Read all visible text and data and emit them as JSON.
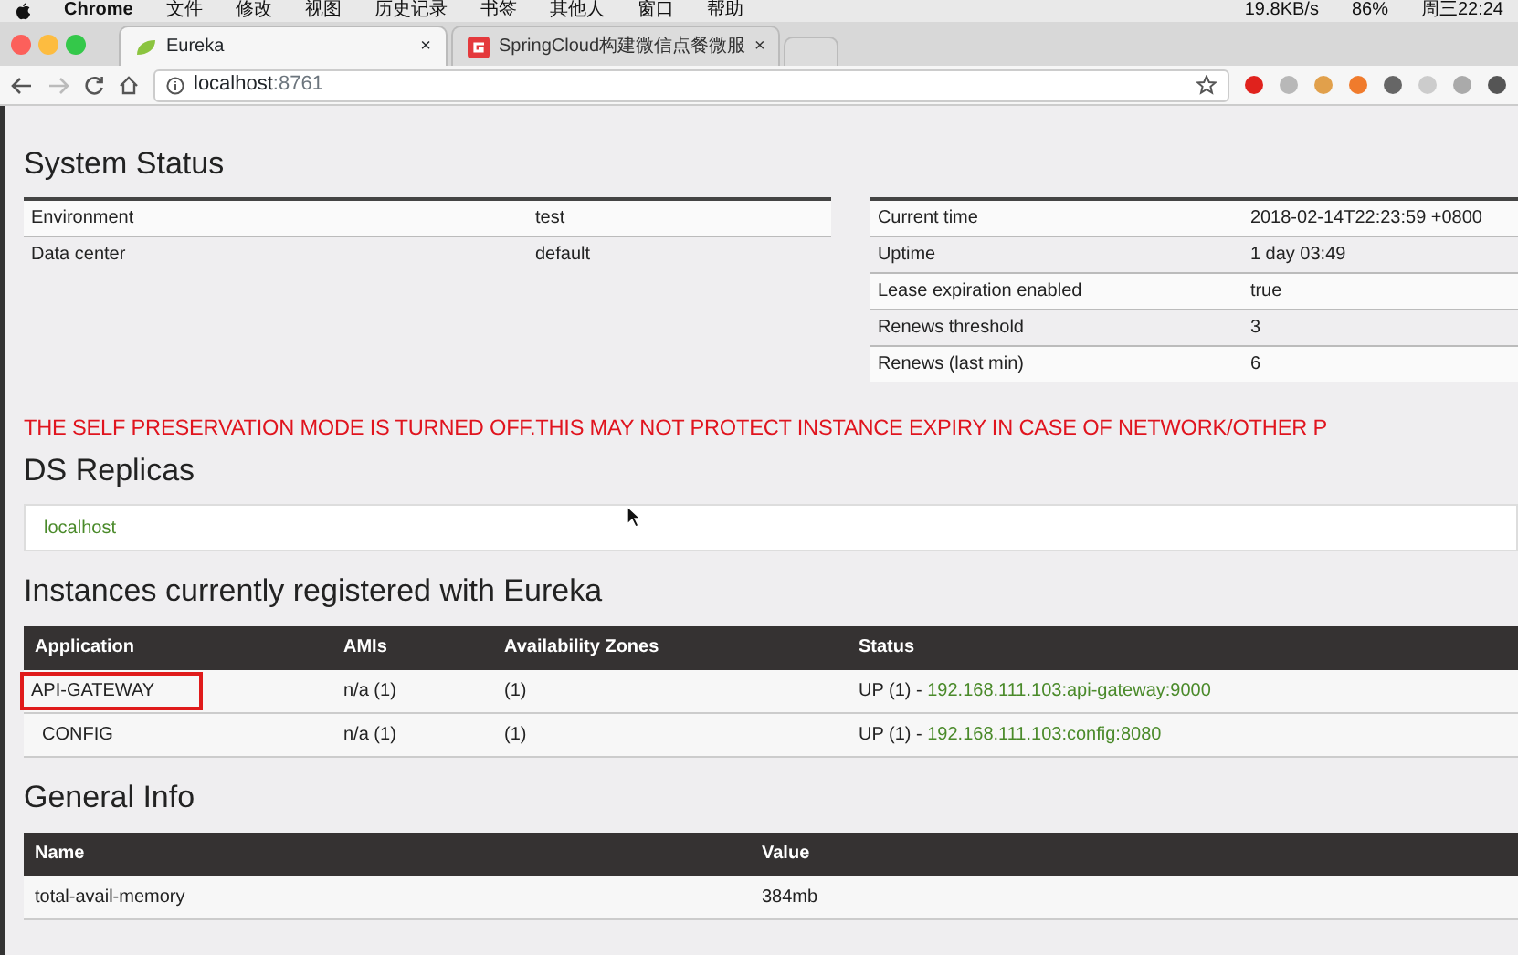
{
  "menu_bar": {
    "app": "Chrome",
    "items": [
      "文件",
      "修改",
      "视图",
      "历史记录",
      "书签",
      "其他人",
      "窗口",
      "帮助"
    ],
    "network_speed": "19.8KB/s",
    "battery": "86%",
    "clock": "周三22:24"
  },
  "tabs": [
    {
      "title": "Eureka",
      "selected": true,
      "close": "×"
    },
    {
      "title": "SpringCloud构建微信点餐微服",
      "selected": false,
      "close": "×"
    }
  ],
  "address_bar": {
    "host": "localhost",
    "port": ":8761"
  },
  "system_status": {
    "title": "System Status",
    "left": [
      {
        "key": "Environment",
        "value": "test"
      },
      {
        "key": "Data center",
        "value": "default"
      }
    ],
    "right": [
      {
        "key": "Current time",
        "value": "2018-02-14T22:23:59 +0800"
      },
      {
        "key": "Uptime",
        "value": "1 day 03:49"
      },
      {
        "key": "Lease expiration enabled",
        "value": "true"
      },
      {
        "key": "Renews threshold",
        "value": "3"
      },
      {
        "key": "Renews (last min)",
        "value": "6"
      }
    ]
  },
  "warning": "THE SELF PRESERVATION MODE IS TURNED OFF.THIS MAY NOT PROTECT INSTANCE EXPIRY IN CASE OF NETWORK/OTHER P",
  "replicas": {
    "title": "DS Replicas",
    "items": [
      "localhost"
    ]
  },
  "instances": {
    "title": "Instances currently registered with Eureka",
    "columns": [
      "Application",
      "AMIs",
      "Availability Zones",
      "Status"
    ],
    "rows": [
      {
        "application": "API-GATEWAY",
        "highlighted": true,
        "amis": "n/a (1)",
        "zones": "(1)",
        "status": "UP (1) -",
        "link": "192.168.111.103:api-gateway:9000"
      },
      {
        "application": "CONFIG",
        "highlighted": false,
        "amis": "n/a (1)",
        "zones": "(1)",
        "status": "UP (1) -",
        "link": "192.168.111.103:config:8080"
      }
    ]
  },
  "general_info": {
    "title": "General Info",
    "columns": [
      "Name",
      "Value"
    ],
    "rows": [
      {
        "name": "total-avail-memory",
        "value": "384mb"
      }
    ]
  }
}
